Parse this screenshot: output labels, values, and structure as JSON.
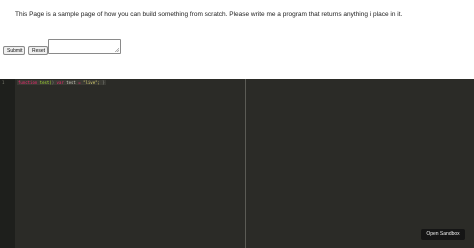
{
  "preview": {
    "intro_text": "This Page is a sample page of how you can build something from scratch. Please write me a program that returns anything i place in it.",
    "form": {
      "submit_label": "Submit",
      "reset_label": "Reset",
      "textarea_value": ""
    }
  },
  "editor": {
    "line_number": "1",
    "code_parts": {
      "p1": "function",
      "p2": " test(",
      "p3": ") ",
      "p4": "var",
      "p5": " test ",
      "p6": "=",
      "p7": " \"live\";",
      "p8": " }"
    },
    "colors": {
      "background": "#2b2b27",
      "gutter": "#1e1f1c"
    }
  },
  "sandbox_button": {
    "label": "Open Sandbox"
  }
}
